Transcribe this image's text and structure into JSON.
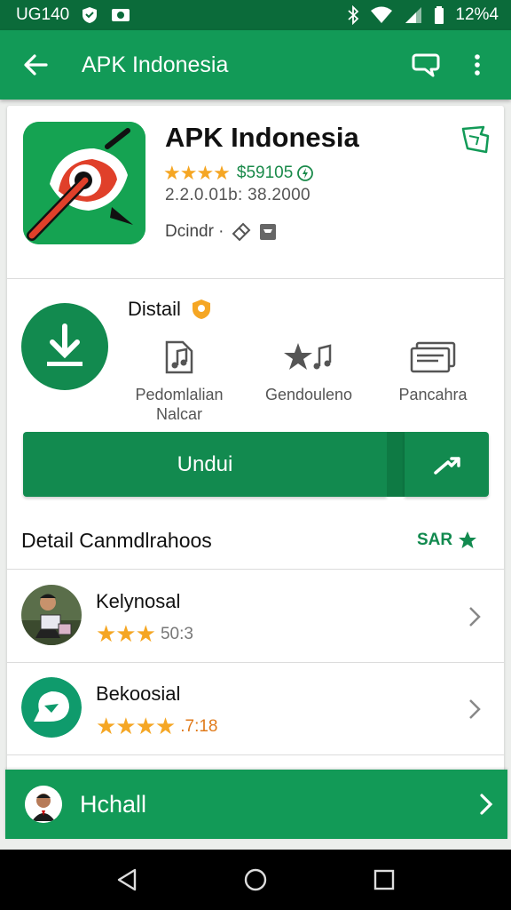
{
  "status_bar": {
    "time_left": "UG140",
    "time_right": "12%4",
    "icons": [
      "shield-icon",
      "photo-icon",
      "bluetooth-icon",
      "wifi-icon",
      "signal-icon",
      "battery-icon"
    ]
  },
  "app_bar": {
    "title": "APK Indonesia",
    "icons": [
      "back-arrow-icon",
      "chat-bubble-icon",
      "more-vert-icon"
    ]
  },
  "app": {
    "name": "APK Indonesia",
    "stars": "★★★★",
    "rating_count": "$59105",
    "version": "2.2.0.01b: 38.2000",
    "developer": "Dcindr ·"
  },
  "detail": {
    "heading": "Distail",
    "features": [
      {
        "icon": "music-file-icon",
        "label_line1": "Pedomlalian",
        "label_line2": "Nalcar"
      },
      {
        "icon": "star-music-icon",
        "label_line1": "Gendouleno",
        "label_line2": ""
      },
      {
        "icon": "cards-icon",
        "label_line1": "Pancahra",
        "label_line2": ""
      }
    ]
  },
  "actions": {
    "install_label": "Undui",
    "share_icon": "share-arrow-icon"
  },
  "list": {
    "heading": "Detail Canmdlrahoos",
    "see_all": "SAR",
    "items": [
      {
        "title": "Kelynosal",
        "stars": "★★★",
        "score": "50:3"
      },
      {
        "title": "Bekoosial",
        "stars": "★★★★",
        "score": ".7:18"
      }
    ]
  },
  "bottom_banner": {
    "label": "Hchall"
  },
  "colors": {
    "primary": "#129a57",
    "primary_dark": "#0b6b3a",
    "accent_star": "#f5a623",
    "button": "#128a4f"
  }
}
